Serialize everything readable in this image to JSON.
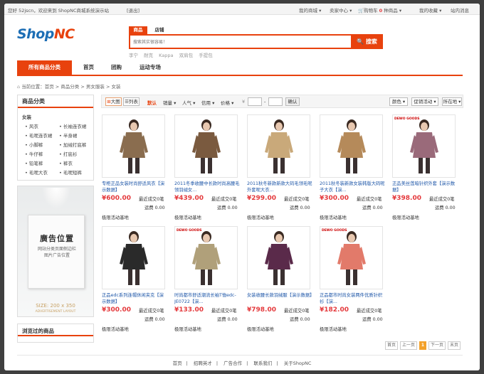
{
  "topbar": {
    "welcome": "您好 52jscn，欢迎来到 ShopNC商城系统演示站",
    "logout": "[退出]",
    "my_mall": "我的商城",
    "seller_center": "卖家中心",
    "cart_prefix": "购物车",
    "cart_count": "0",
    "cart_suffix": "种商品",
    "my_favorites": "我的收藏",
    "messages": "站内消息"
  },
  "logo": {
    "shop": "Shop",
    "nc": "NC"
  },
  "search": {
    "tab_goods": "商品",
    "tab_store": "店铺",
    "placeholder": "搜索其实很容易！",
    "button": "搜索",
    "hot_words": [
      "李宁",
      "耐克",
      "Kappa",
      "双肩包",
      "手提包"
    ]
  },
  "nav": {
    "category_tab": "所有商品分类",
    "items": [
      "首页",
      "团购",
      "运动专场"
    ]
  },
  "breadcrumb": {
    "current": "当前位置：",
    "path": "首页 > 商品分类 > 男女服装 > 女装"
  },
  "sidebar": {
    "title": "商品分类",
    "category": "女装",
    "items": [
      "风衣",
      "长袖连衣裙",
      "毛呢连衣裙",
      "半身裙",
      "小脚裤",
      "加绒打底裤",
      "牛仔裤",
      "打底衫",
      "铅笔裤",
      "裤衣",
      "毛呢大衣",
      "毛呢短裤"
    ]
  },
  "ad": {
    "title": "廣告位置",
    "sub1": "网站分类页面侧边栏",
    "sub2": "图片广告位置",
    "size": "SIZE: 200 x 350",
    "layout": "ADVERTISEMENT LAYOUT"
  },
  "viewed": {
    "title": "浏览过的商品"
  },
  "toolbar": {
    "big_view": "大图",
    "list_view": "列表",
    "sort_default": "默认",
    "sort_sales": "销量",
    "sort_popularity": "人气",
    "sort_credit": "信用",
    "sort_price": "价格",
    "currency": "¥",
    "dash": "-",
    "confirm": "确认",
    "filter_color": "颜色",
    "filter_promo": "促销活动",
    "filter_location": "所在地"
  },
  "products": [
    {
      "title": "专柜正品女装时尚舒适风衣【演示数据】",
      "price": "¥600.00",
      "sold": "最近成交0笔",
      "ship": "运费 0.00",
      "promo": "极限活动基地",
      "brand": "",
      "coat": "#8a6d4f"
    },
    {
      "title": "2011冬季收腰中长款时尚高腰毛领羽绒女...",
      "price": "¥439.00",
      "sold": "最近成交0笔",
      "ship": "运费 0.00",
      "promo": "极限活动基地",
      "brand": "",
      "coat": "#7a5a3f"
    },
    {
      "title": "2011秋冬新款新款大码毛领毛呢外套呢大衣...",
      "price": "¥299.00",
      "sold": "最近成交0笔",
      "ship": "运费 0.00",
      "promo": "极限活动基地",
      "brand": "",
      "coat": "#c9a97a"
    },
    {
      "title": "2011秋冬装新款女装韩版大码呢子大衣【演...",
      "price": "¥300.00",
      "sold": "最近成交0笔",
      "ship": "运费 0.00",
      "promo": "极限活动基地",
      "brand": "",
      "coat": "#b58a5a"
    },
    {
      "title": "正品美丝莲暗针织外套【演示数据】",
      "price": "¥398.00",
      "sold": "最近成交0笔",
      "ship": "运费 0.00",
      "promo": "极限活动基地",
      "brand": "DEWO GOODS",
      "coat": "#9a6a7a"
    },
    {
      "title": "正品edc系列连帽休闲夹克【演示数据】",
      "price": "¥300.00",
      "sold": "最近成交0笔",
      "ship": "运费 0.00",
      "promo": "极限活动基地",
      "brand": "",
      "coat": "#2a2a2a"
    },
    {
      "title": "时尚都市舒适潮流长袖T恤edc-JE0722【演...",
      "price": "¥133.00",
      "sold": "最近成交0笔",
      "ship": "运费 0.00",
      "promo": "极限活动基地",
      "brand": "DEWO GOODS",
      "coat": "#b0a07a"
    },
    {
      "title": "女装收腰长款羽绒服【演示数据】",
      "price": "¥798.00",
      "sold": "最近成交0笔",
      "ship": "运费 0.00",
      "promo": "极限活动基地",
      "brand": "",
      "coat": "#5a2a4a"
    },
    {
      "title": "正品都市时尚女装两件优质针织衫【演...",
      "price": "¥182.00",
      "sold": "最近成交0笔",
      "ship": "运费 0.00",
      "promo": "极限活动基地",
      "brand": "DEWO GOODS",
      "coat": "#e27a6a"
    }
  ],
  "pagination": {
    "first": "首页",
    "prev": "上一页",
    "current": "1",
    "next": "下一页",
    "last": "末页"
  },
  "footer": {
    "links": [
      "首页",
      "招聘英才",
      "广告合作",
      "联系我们",
      "关于ShopNC"
    ],
    "sep": "|"
  }
}
